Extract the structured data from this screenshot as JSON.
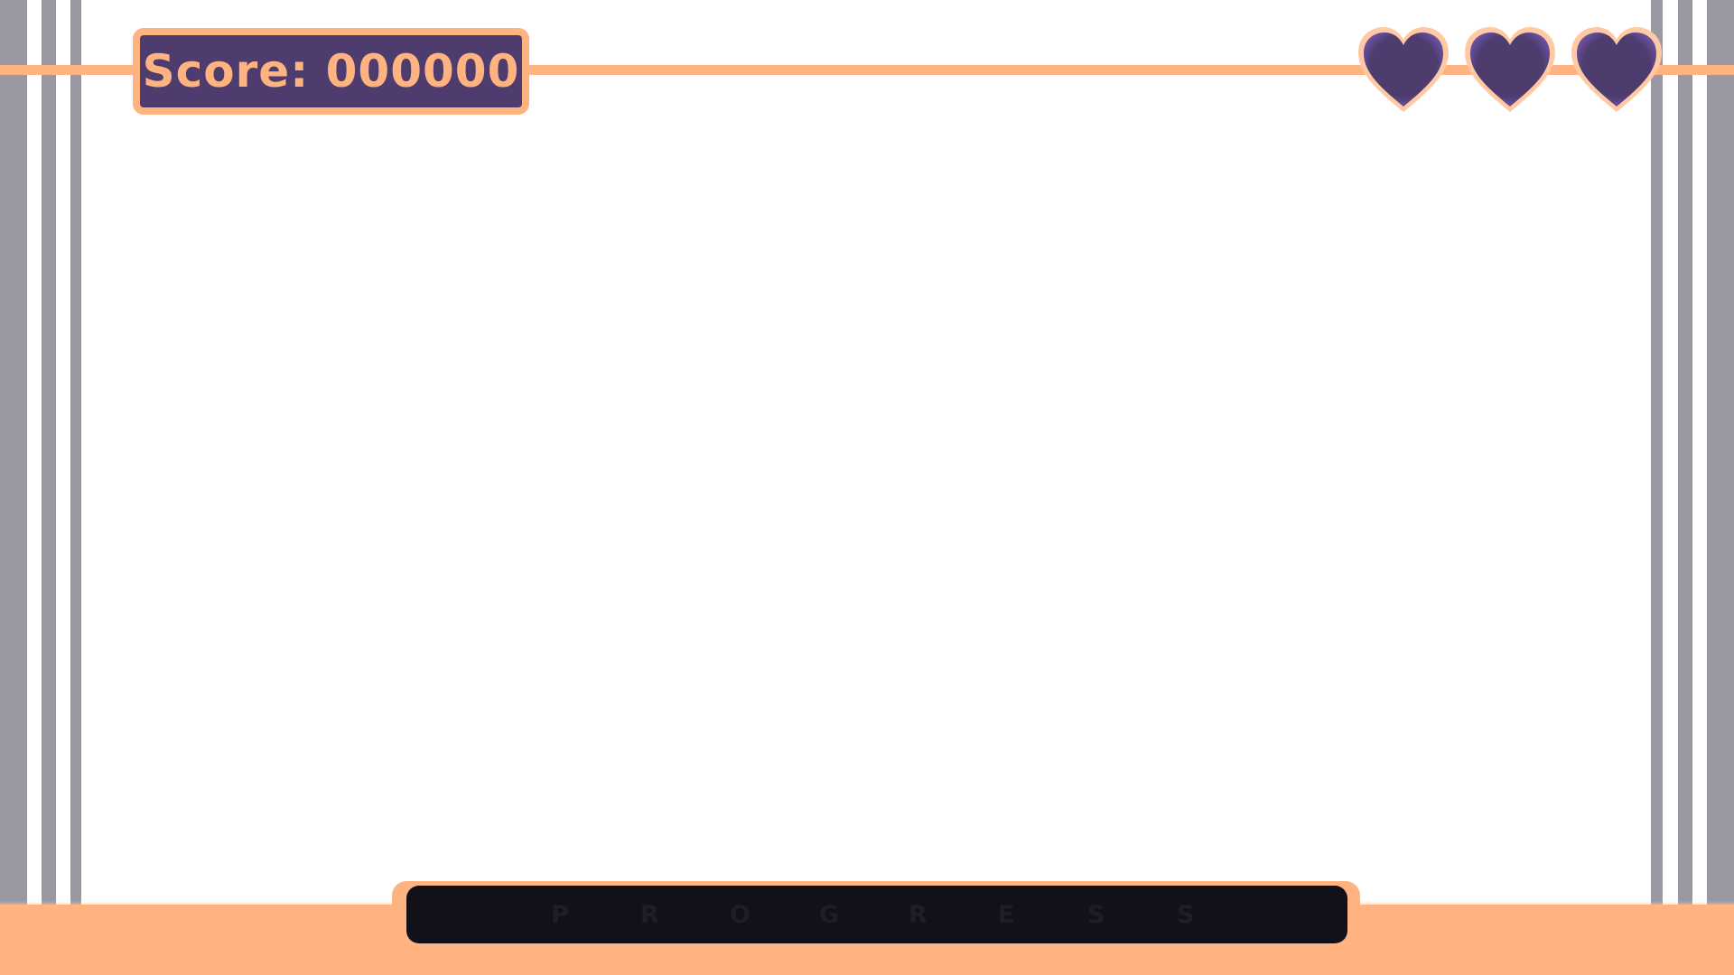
{
  "hud": {
    "score_label": "Score: 000000",
    "lives": {
      "current": 3,
      "max": 3,
      "icon": "heart-icon"
    }
  },
  "progress": {
    "letters": [
      "P",
      "R",
      "O",
      "G",
      "R",
      "E",
      "S",
      "S"
    ],
    "value": 0
  },
  "colors": {
    "accent": "#ffb380",
    "panel": "#4d3c6d",
    "heart_fill": "#4d3c6d",
    "stripes": "#9a99a3",
    "track": "#121018",
    "background": "#ffffff"
  }
}
